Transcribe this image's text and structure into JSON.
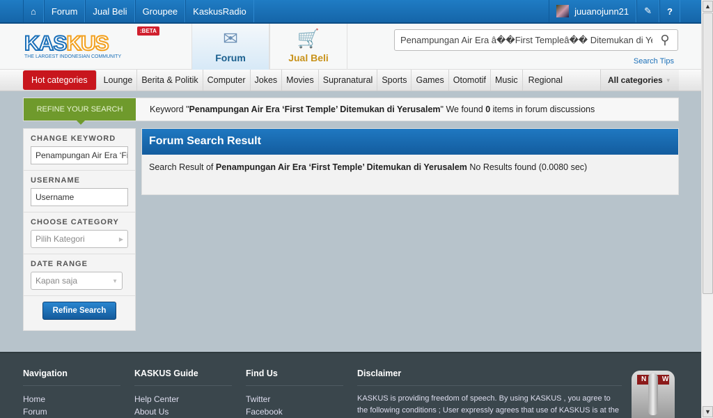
{
  "topnav": {
    "home_icon": "home-icon",
    "items": [
      "Forum",
      "Jual Beli",
      "Groupee",
      "KaskusRadio"
    ],
    "username": "juuanojunn21",
    "edit_icon": "pencil-icon",
    "help_icon": "help-icon"
  },
  "header": {
    "logo": "KASKUS",
    "logo_tagline": "THE LARGEST INDONESIAN COMMUNITY",
    "beta": ":BETA",
    "tabs": [
      "Forum",
      "Jual Beli"
    ],
    "search_value": "Penampungan Air Era â��First Templeâ�� Ditemukan di Yerusalem",
    "search_tips": "Search Tips"
  },
  "categories": {
    "hot": "Hot categories",
    "items": [
      "Lounge",
      "Berita & Politik",
      "Computer",
      "Jokes",
      "Movies",
      "Supranatural",
      "Sports",
      "Games",
      "Otomotif",
      "Music",
      "Regional"
    ],
    "all": "All categories"
  },
  "refine": {
    "label": "REFINE YOUR SEARCH",
    "kw_prefix": "Keyword \"",
    "keyword": "Penampungan Air Era ‘First Temple’ Ditemukan di Yerusalem",
    "kw_mid": "\" We found ",
    "count": "0",
    "kw_suffix": " items in forum discussions"
  },
  "sidebar": {
    "change_keyword": "CHANGE KEYWORD",
    "keyword_value": "Penampungan Air Era ‘First Temple’ Ditemukan di Yerusalem",
    "username_label": "USERNAME",
    "username_placeholder": "Username",
    "category_label": "CHOOSE CATEGORY",
    "category_value": "Pilih Kategori",
    "date_label": "DATE RANGE",
    "date_value": "Kapan saja",
    "button": "Refine Search"
  },
  "result": {
    "title": "Forum Search Result",
    "prefix": "Search Result of ",
    "keyword": "Penampungan Air Era ‘First Temple’ Ditemukan di Yerusalem",
    "suffix": " No Results found (0.0080 sec)"
  },
  "footer": {
    "nav_title": "Navigation",
    "nav": [
      "Home",
      "Forum"
    ],
    "guide_title": "KASKUS Guide",
    "guide": [
      "Help Center",
      "About Us"
    ],
    "find_title": "Find Us",
    "find": [
      "Twitter",
      "Facebook"
    ],
    "disc_title": "Disclaimer",
    "disclaimer": "KASKUS is providing freedom of speech. By using KASKUS , you agree to the following conditions ; User expressly agrees that use of KASKUS is at the",
    "switch_label": "NEW"
  }
}
